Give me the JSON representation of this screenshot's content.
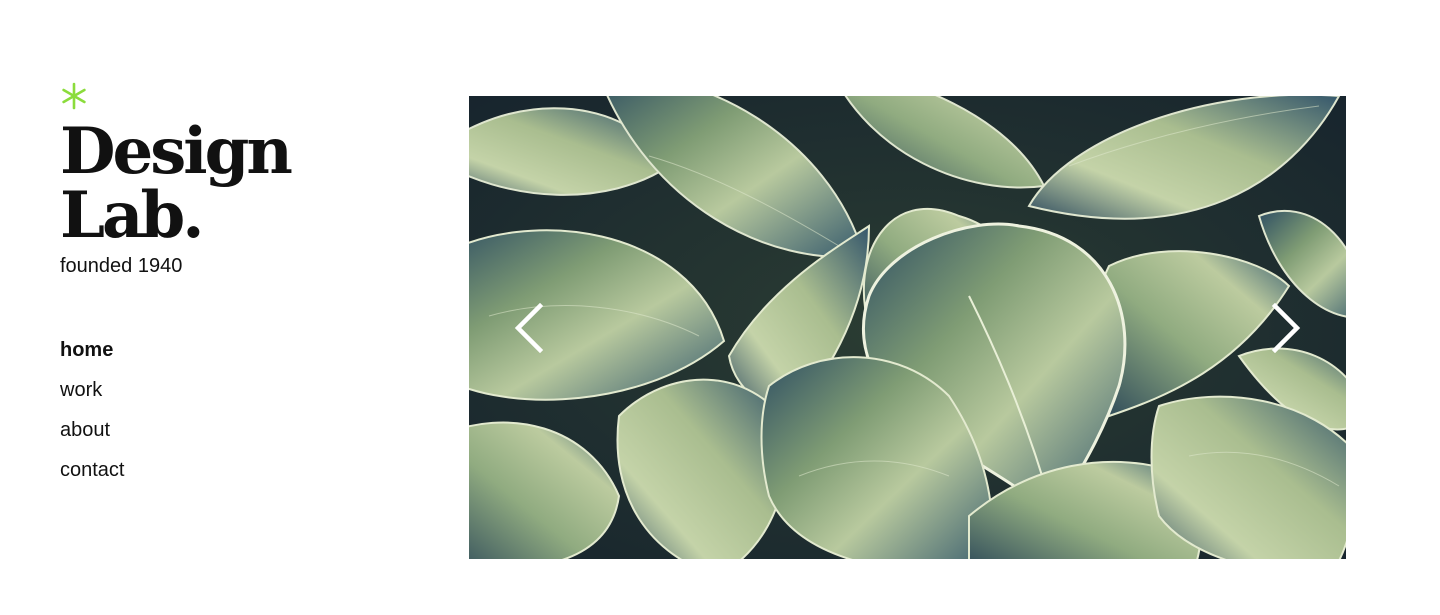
{
  "brand": {
    "mark_icon": "asterisk-icon",
    "mark_color": "#8bdc3c",
    "title": "Design Lab.",
    "subtitle": "founded 1940"
  },
  "nav": {
    "items": [
      {
        "label": "home",
        "active": true
      },
      {
        "label": "work",
        "active": false
      },
      {
        "label": "about",
        "active": false
      },
      {
        "label": "contact",
        "active": false
      }
    ]
  },
  "slider": {
    "image": "hosta-leaves-photo",
    "prev_icon": "chevron-left-icon",
    "next_icon": "chevron-right-icon",
    "arrow_color": "#ffffff"
  }
}
